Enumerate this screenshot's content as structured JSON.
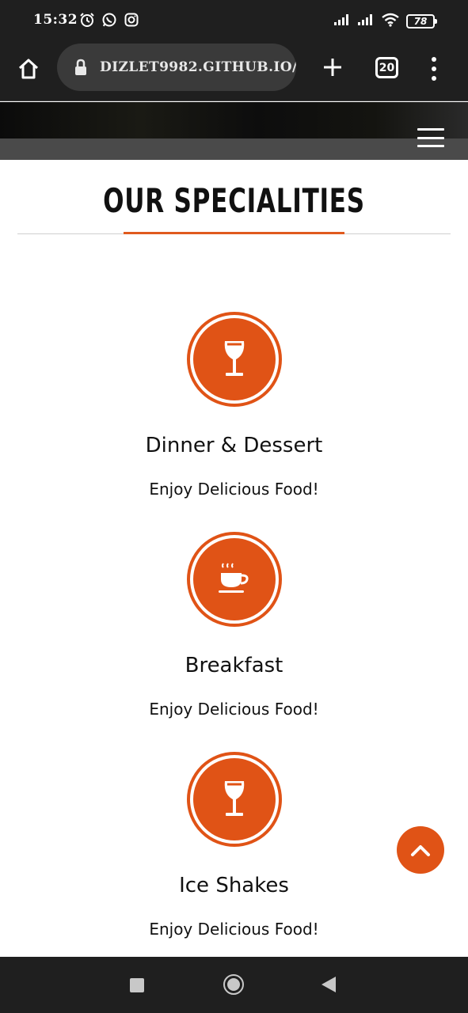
{
  "status_bar": {
    "time": "15:32",
    "battery": "78",
    "icons": [
      "alarm-icon",
      "whatsapp-icon",
      "instagram-icon",
      "signal-icon",
      "signal-icon",
      "wifi-icon",
      "battery-icon"
    ]
  },
  "browser": {
    "url": "DIZLET9982.GITHUB.IO/",
    "tab_count": "20",
    "icons": [
      "home-icon",
      "lock-icon",
      "new-tab-icon",
      "tabs-icon",
      "more-icon"
    ]
  },
  "site": {
    "section_title": "OUR SPECIALITIES",
    "specialities": [
      {
        "name": "Dinner & Dessert",
        "description": "Enjoy Delicious Food!",
        "icon": "wine-glass-icon"
      },
      {
        "name": "Breakfast",
        "description": "Enjoy Delicious Food!",
        "icon": "coffee-cup-icon"
      },
      {
        "name": "Ice Shakes",
        "description": "Enjoy Delicious Food!",
        "icon": "wine-glass-icon"
      }
    ]
  },
  "colors": {
    "accent": "#e05316",
    "dark_bar": "#1f1f1f",
    "nav_strip": "#4a4a4a"
  }
}
